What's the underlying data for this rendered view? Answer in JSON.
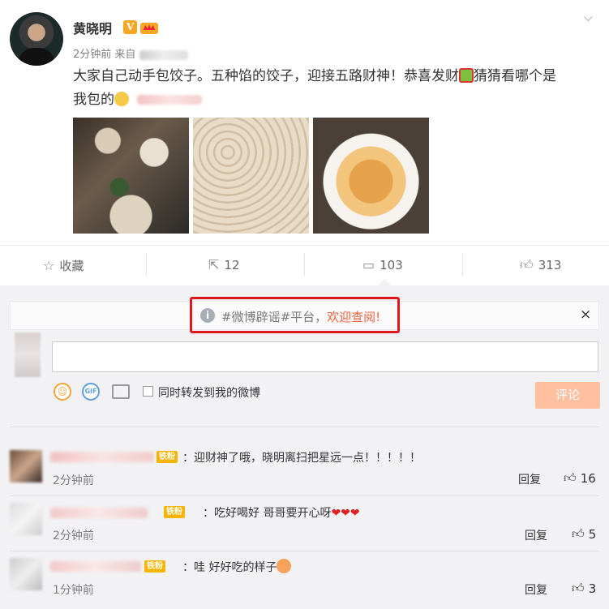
{
  "post": {
    "username": "黄晓明",
    "verified_badge": "V",
    "time": "2分钟前",
    "source_prefix": "来自",
    "text_line1": "大家自己动手包饺子。五种馅的饺子，迎接五路财神！恭喜发财",
    "text_line1b": "猜猜看哪个是",
    "text_line2": "我包的",
    "menu_icon": "chevron-down-icon"
  },
  "actions": {
    "favorite": "收藏",
    "repost": "12",
    "comment": "103",
    "like": "313"
  },
  "notice": {
    "text_pre": "#微博辟谣#平台，",
    "text_link": "欢迎查阅!",
    "close": "×"
  },
  "composer": {
    "placeholder": "",
    "sync_label": "同时转发到我的微博",
    "submit_label": "评论",
    "gif_label": "GIF"
  },
  "comments": [
    {
      "badge": "铁粉",
      "text": "：迎财神了哦，晓明离扫把星远一点！！！！！",
      "time": "2分钟前",
      "reply": "回复",
      "likes": "16"
    },
    {
      "badge": "铁粉",
      "text": "：吃好喝好 哥哥要开心呀",
      "time": "2分钟前",
      "reply": "回复",
      "likes": "5"
    },
    {
      "badge": "铁粉",
      "text": "：哇 好好吃的样子",
      "time": "1分钟前",
      "reply": "回复",
      "likes": "3"
    }
  ],
  "colors": {
    "accent": "#f06442",
    "highlight_box": "#e0161e",
    "submit_bg": "#ffc09f",
    "badge": "#f7b500"
  }
}
